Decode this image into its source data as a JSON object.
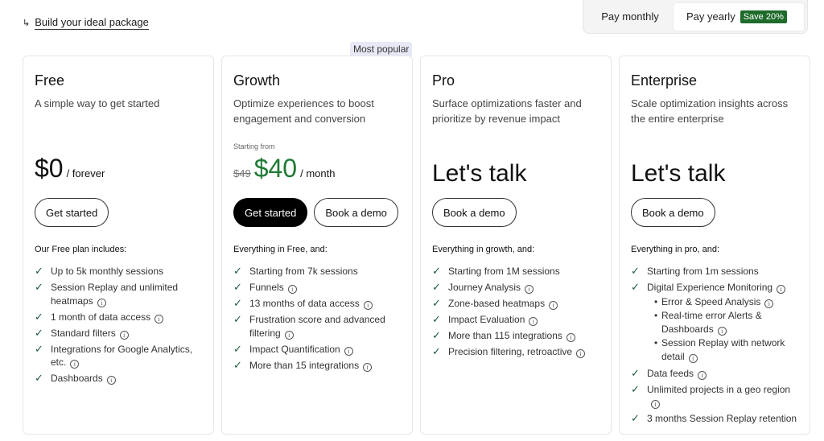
{
  "header": {
    "build_link_label": "Build your ideal package",
    "toggle": {
      "monthly_label": "Pay monthly",
      "yearly_label": "Pay yearly",
      "save_badge": "Save 20%",
      "selected": "yearly"
    }
  },
  "popular_badge": "Most popular",
  "plans": [
    {
      "name": "Free",
      "description": "A simple way to get started",
      "starting_label": "",
      "price_old": "",
      "price": "$0",
      "price_unit": "/ forever",
      "buttons": [
        "Get started"
      ],
      "includes_heading": "Our Free plan includes:",
      "features": [
        {
          "text": "Up to 5k monthly sessions",
          "info": false
        },
        {
          "text": "Session Replay and unlimited heatmaps",
          "info": true
        },
        {
          "text": "1 month of data access",
          "info": true
        },
        {
          "text": "Standard filters",
          "info": true
        },
        {
          "text": "Integrations for Google Analytics, etc.",
          "info": true
        },
        {
          "text": "Dashboards",
          "info": true
        }
      ]
    },
    {
      "name": "Growth",
      "description": "Optimize experiences to boost engagement and conversion",
      "starting_label": "Starting from",
      "price_old": "$49",
      "price": "$40",
      "price_unit": "/ month",
      "buttons": [
        "Get started",
        "Book a demo"
      ],
      "includes_heading": "Everything in Free, and:",
      "features": [
        {
          "text": "Starting from 7k sessions",
          "info": false
        },
        {
          "text": "Funnels",
          "info": true
        },
        {
          "text": "13 months of data access",
          "info": true
        },
        {
          "text": "Frustration score and advanced filtering",
          "info": true
        },
        {
          "text": "Impact Quantification",
          "info": true
        },
        {
          "text": "More than 15 integrations",
          "info": true
        }
      ]
    },
    {
      "name": "Pro",
      "description": "Surface optimizations faster and prioritize by revenue impact",
      "price_text": "Let's talk",
      "buttons": [
        "Book a demo"
      ],
      "includes_heading": "Everything in growth, and:",
      "features": [
        {
          "text": "Starting from 1M sessions",
          "info": false
        },
        {
          "text": "Journey Analysis",
          "info": true
        },
        {
          "text": "Zone-based heatmaps",
          "info": true
        },
        {
          "text": "Impact Evaluation",
          "info": true
        },
        {
          "text": "More than 115 integrations",
          "info": true
        },
        {
          "text": "Precision filtering, retroactive",
          "info": true
        }
      ]
    },
    {
      "name": "Enterprise",
      "description": "Scale optimization insights across the entire enterprise",
      "price_text": "Let's talk",
      "buttons": [
        "Book a demo"
      ],
      "includes_heading": "Everything in pro, and:",
      "features": [
        {
          "text": "Starting from 1m sessions",
          "info": false
        },
        {
          "text": "Digital Experience Monitoring",
          "info": true
        },
        {
          "text": "Data feeds",
          "info": true
        },
        {
          "text": "Unlimited projects in a geo region",
          "info": true
        },
        {
          "text": "3 months Session Replay retention",
          "info": false
        }
      ],
      "sub_features": [
        {
          "text": "Error & Speed Analysis",
          "info": true
        },
        {
          "text": "Real-time error Alerts & Dashboards",
          "info": true
        },
        {
          "text": "Session Replay with network detail",
          "info": true
        }
      ]
    }
  ]
}
